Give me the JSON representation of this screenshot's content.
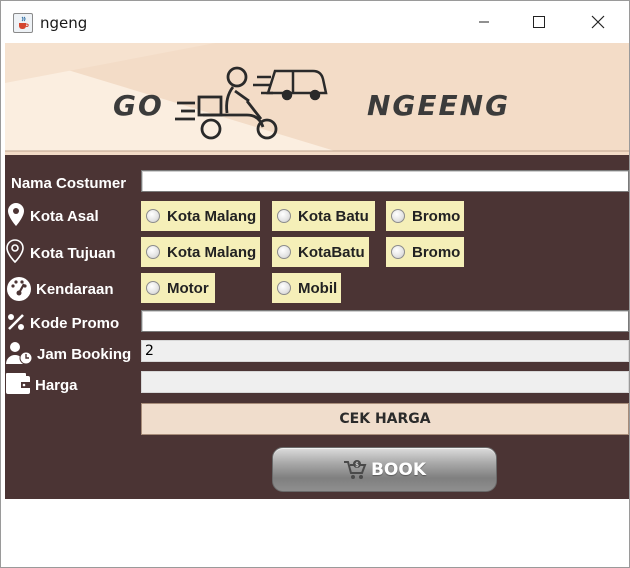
{
  "window": {
    "title": "ngeng"
  },
  "banner": {
    "left_text": "GO",
    "right_text": "NGEENG"
  },
  "form": {
    "nama_label": "Nama Costumer",
    "nama_value": "",
    "asal_label": "Kota Asal",
    "asal_options": [
      "Kota Malang",
      "Kota Batu",
      "Bromo"
    ],
    "tujuan_label": "Kota Tujuan",
    "tujuan_options": [
      "Kota Malang",
      "KotaBatu",
      "Bromo"
    ],
    "kendaraan_label": "Kendaraan",
    "kendaraan_options": [
      "Motor",
      "Mobil"
    ],
    "promo_label": "Kode Promo",
    "promo_value": "",
    "jam_label": "Jam Booking",
    "jam_value": "2",
    "harga_label": "Harga",
    "harga_value": ""
  },
  "buttons": {
    "cek_label": "CEK HARGA",
    "book_label": "BOOK"
  },
  "colors": {
    "panel": "#4b3434",
    "radio_bg": "#f5efb8",
    "banner_bg": "#f2dcc8",
    "cek_bg": "#f0ddcc"
  },
  "icons": {
    "app": "java-cup-icon",
    "asal": "location-pin-icon",
    "tujuan": "location-pin-outline-icon",
    "kendaraan": "speedometer-icon",
    "promo": "percent-icon",
    "jam": "user-clock-icon",
    "harga": "wallet-icon",
    "book": "cart-icon"
  }
}
